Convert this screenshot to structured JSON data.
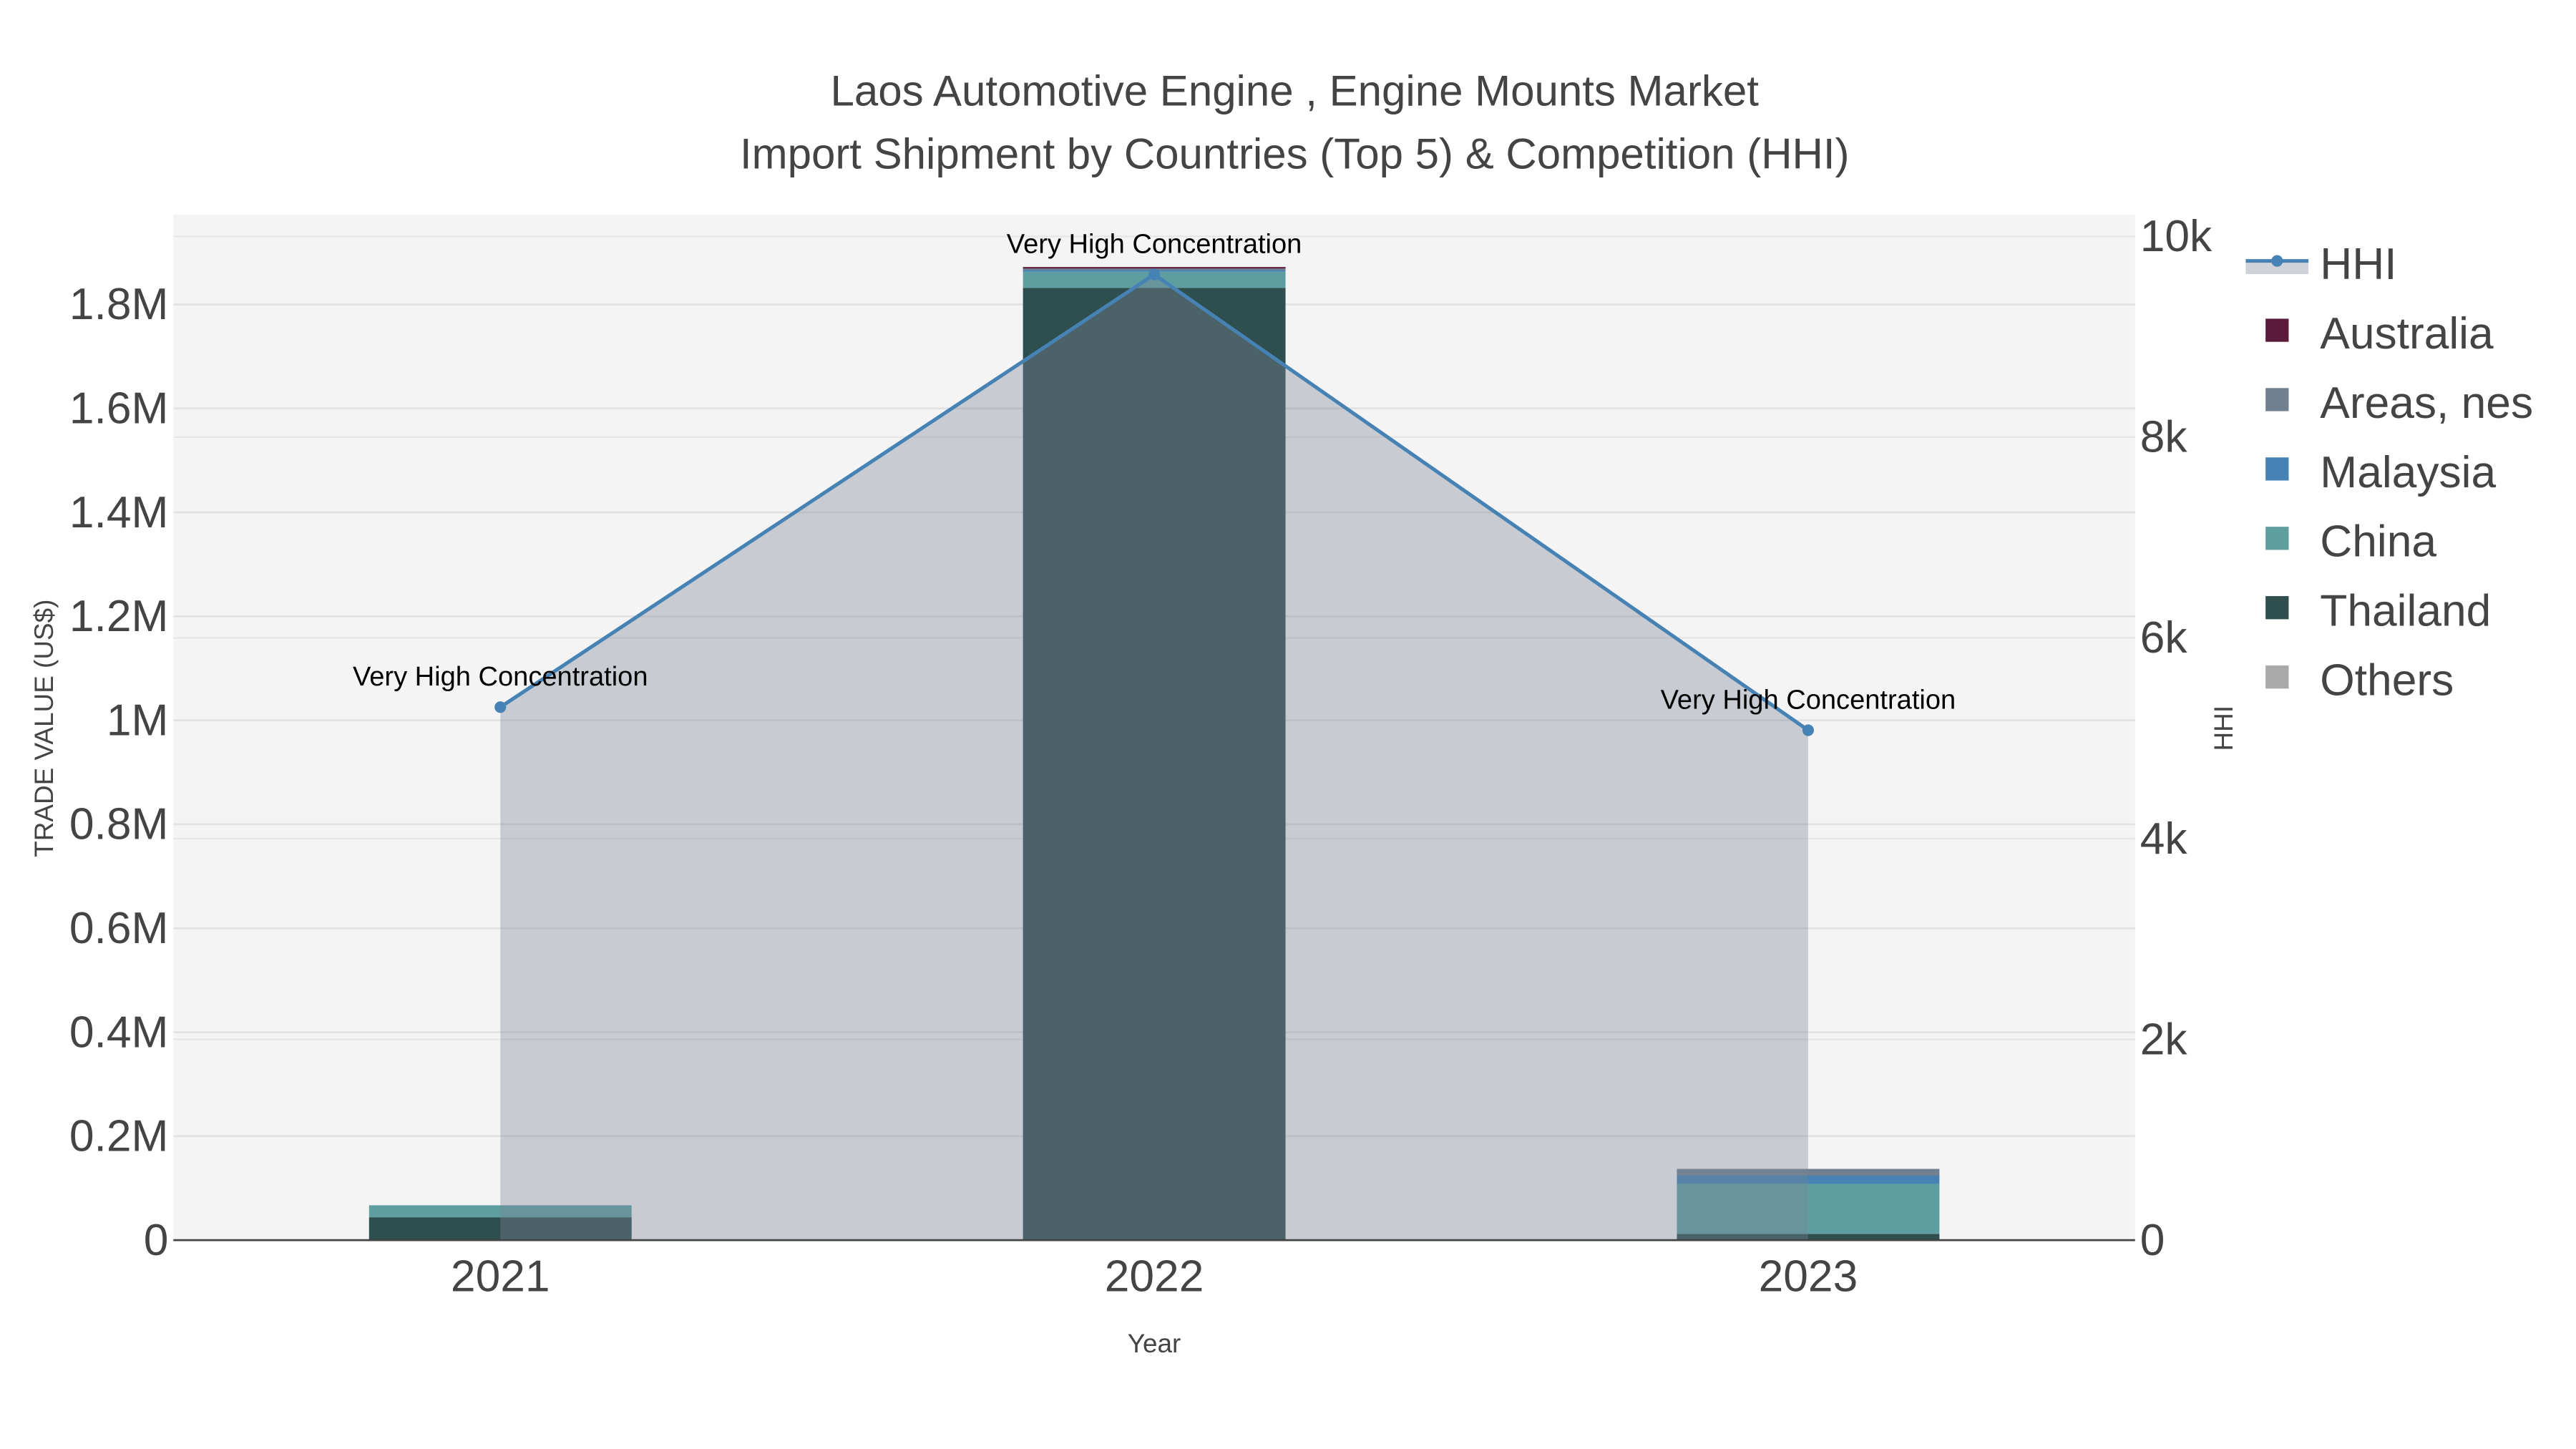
{
  "chart_data": {
    "type": "bar",
    "stacked": true,
    "title": "Laos Automotive Engine , Engine Mounts Market",
    "subtitle": "Import Shipment by Countries (Top 5) & Competition (HHI)",
    "xlabel": "Year",
    "ylabel": "TRADE VALUE (US$)",
    "y2label": "HHI",
    "categories": [
      "2021",
      "2022",
      "2023"
    ],
    "ylim": [
      0,
      1960000
    ],
    "y2lim": [
      0,
      10200
    ],
    "yticks": [
      0,
      200000,
      400000,
      600000,
      800000,
      1000000,
      1200000,
      1400000,
      1600000,
      1800000
    ],
    "ytick_labels": [
      "0",
      "0.2M",
      "0.4M",
      "0.6M",
      "0.8M",
      "1M",
      "1.2M",
      "1.4M",
      "1.6M",
      "1.8M"
    ],
    "y2ticks": [
      0,
      2000,
      4000,
      6000,
      8000,
      10000
    ],
    "y2tick_labels": [
      "0",
      "2k",
      "4k",
      "6k",
      "8k",
      "10k"
    ],
    "grid": true,
    "legend_position": "right",
    "series": [
      {
        "name": "Thailand",
        "color": "#2f4f4f",
        "values": [
          44000,
          1832000,
          12000
        ]
      },
      {
        "name": "China",
        "color": "#5f9ea0",
        "values": [
          23000,
          31000,
          96000
        ]
      },
      {
        "name": "Malaysia",
        "color": "#4682b4",
        "values": [
          0,
          3000,
          16000
        ]
      },
      {
        "name": "Areas, nes",
        "color": "#708090",
        "values": [
          0,
          3000,
          13000
        ]
      },
      {
        "name": "Australia",
        "color": "#5c1a3a",
        "values": [
          0,
          3000,
          0
        ]
      },
      {
        "name": "Others",
        "color": "#aaaaaa",
        "values": [
          0,
          0,
          0
        ]
      }
    ],
    "hhi": {
      "name": "HHI",
      "color": "#4682b4",
      "values": [
        5310,
        9620,
        5080
      ]
    },
    "annotations": [
      "Very High Concentration",
      "Very High Concentration",
      "Very High Concentration"
    ],
    "legend_order": [
      "HHI",
      "Australia",
      "Areas, nes",
      "Malaysia",
      "China",
      "Thailand",
      "Others"
    ]
  }
}
